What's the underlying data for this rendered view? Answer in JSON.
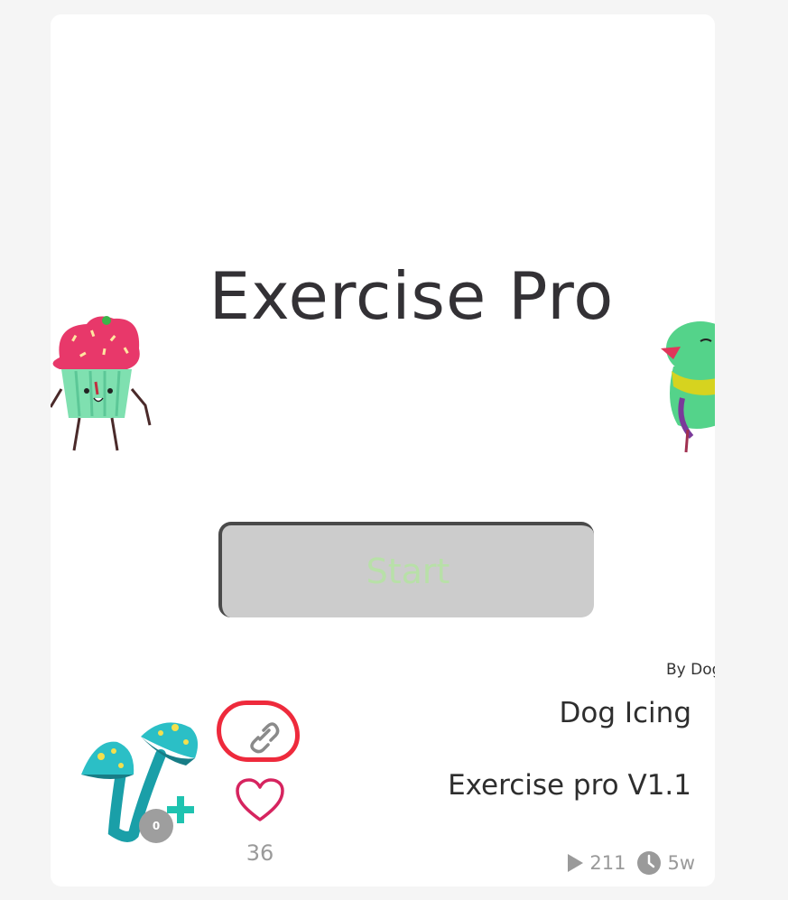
{
  "preview": {
    "app_title": "Exercise Pro",
    "start_label": "Start",
    "by_line": "By Dog Icing"
  },
  "author": {
    "name": "Dog Icing",
    "badge_count": "0"
  },
  "project": {
    "title": "Exercise pro V1.1",
    "likes": "36",
    "plays": "211",
    "age": "5w"
  },
  "icons": {
    "avatar": "mushroom-avatar-icon",
    "follow": "plus-icon",
    "link": "link-icon",
    "like": "heart-icon",
    "plays": "play-icon",
    "age": "clock-icon"
  },
  "colors": {
    "heart": "#d6245f",
    "annotation": "#ee2a3c",
    "plus": "#1fc3b0",
    "start_text": "#b8e0a8"
  }
}
